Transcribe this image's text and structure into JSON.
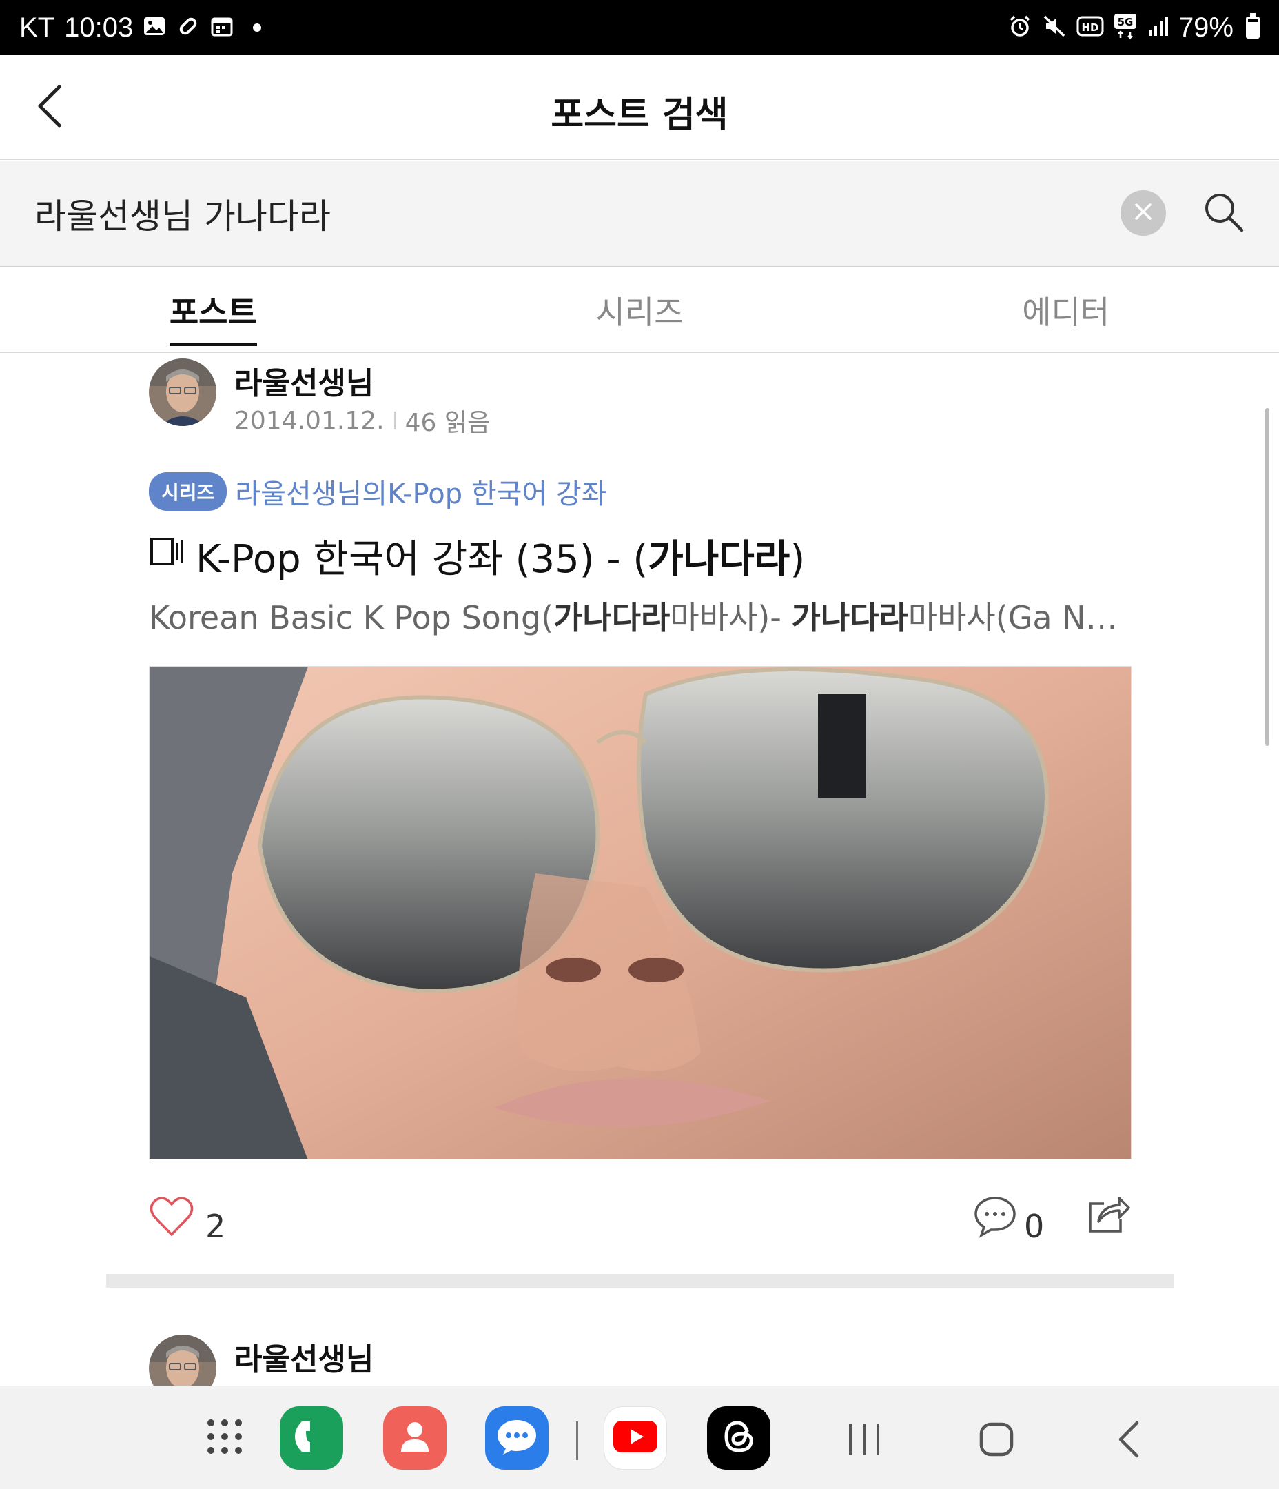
{
  "status_bar": {
    "carrier": "KT",
    "time": "10:03",
    "network": "5G",
    "battery": "79%",
    "battery_level": 0.79,
    "icons": [
      "gallery-icon",
      "link-icon",
      "calendar-icon",
      "alarm-icon",
      "mute-icon",
      "hd-icon",
      "5g-icon",
      "signal-icon",
      "battery-icon"
    ]
  },
  "header": {
    "title": "포스트 검색",
    "back_icon": "chevron-left-icon"
  },
  "search": {
    "value": "라울선생님 가나다라",
    "clear_icon": "clear-icon",
    "search_icon": "search-icon"
  },
  "tabs": [
    {
      "label": "포스트",
      "active": true
    },
    {
      "label": "시리즈",
      "active": false
    },
    {
      "label": "에디터",
      "active": false
    }
  ],
  "results": [
    {
      "author": "라울선생님",
      "date": "2014.01.12.",
      "reads": "46 읽음",
      "series_badge": "시리즈",
      "series_name": "라울선생님의K-Pop 한국어 강좌",
      "title_prefix": "K-Pop 한국어 강좌 (35) - (",
      "title_highlight": "가나다라",
      "title_suffix": ")",
      "excerpt_1": "Korean Basic K Pop Song(",
      "excerpt_hl_1": "가나다라",
      "excerpt_2": "마바사)- ",
      "excerpt_hl_2": "가나다라",
      "excerpt_3": "마바사(Ga Na ...",
      "likes": "2",
      "comments": "0"
    },
    {
      "author": "라울선생님"
    }
  ],
  "navbar": {
    "apps": [
      "apps-grid-icon",
      "phone-app-icon",
      "contacts-app-icon",
      "messages-app-icon",
      "youtube-app-icon",
      "threads-app-icon"
    ],
    "system": [
      "recents-icon",
      "home-icon",
      "back-icon"
    ]
  },
  "colors": {
    "accent": "#5f84c9",
    "status_bar": "#000000",
    "like_heart": "#e0555d"
  }
}
